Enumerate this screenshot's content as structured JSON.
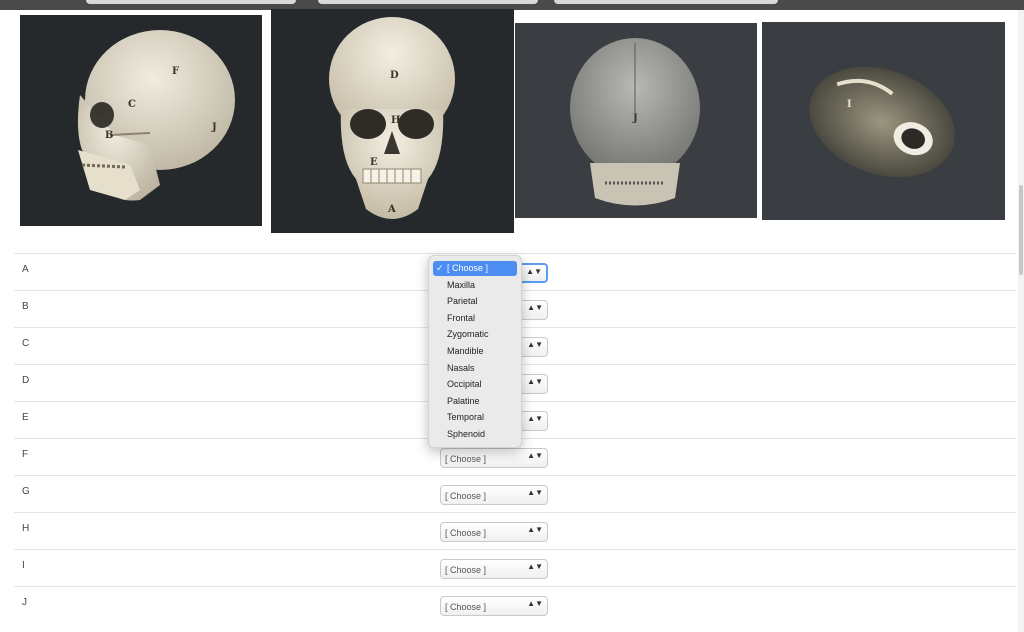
{
  "images": [
    {
      "view": "lateral",
      "labels": [
        "F",
        "C",
        "G",
        "B",
        "J"
      ]
    },
    {
      "view": "anterior",
      "labels": [
        "D",
        "H",
        "E",
        "A"
      ]
    },
    {
      "view": "posterior",
      "labels": [
        "J"
      ]
    },
    {
      "view": "inferior",
      "labels": [
        "I"
      ]
    }
  ],
  "rows": [
    {
      "label": "A",
      "value": ""
    },
    {
      "label": "B",
      "value": ""
    },
    {
      "label": "C",
      "value": ""
    },
    {
      "label": "D",
      "value": ""
    },
    {
      "label": "E",
      "value": ""
    },
    {
      "label": "F",
      "value": "[ Choose ]"
    },
    {
      "label": "G",
      "value": "[ Choose ]"
    },
    {
      "label": "H",
      "value": "[ Choose ]"
    },
    {
      "label": "I",
      "value": "[ Choose ]"
    },
    {
      "label": "J",
      "value": "[ Choose ]"
    }
  ],
  "dropdown": {
    "selected_mark": "✓",
    "options": [
      "[ Choose ]",
      "Maxilla",
      "Parietal",
      "Frontal",
      "Zygomatic",
      "Mandible",
      "Nasals",
      "Occipital",
      "Palatine",
      "Temporal",
      "Sphenoid"
    ]
  },
  "select_arrow": "▲▼",
  "colors": {
    "accent": "#4b8df0",
    "image_bg": "#26292c",
    "bone": "#e9e2cf"
  }
}
